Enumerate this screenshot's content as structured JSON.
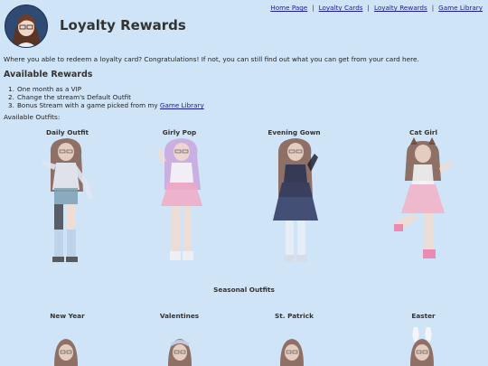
{
  "header": {
    "title": "Loyalty Rewards",
    "nav": [
      "Home Page",
      "Loyalty Cards",
      "Loyalty Rewards",
      "Game Library"
    ],
    "separator": "|"
  },
  "intro": "Where you able to redeem a loyalty card? Congratulations! If not, you can still find out what you can get from your card here.",
  "available_rewards": {
    "heading": "Available Rewards",
    "items": [
      {
        "num": "1.",
        "text": "One month as a VIP"
      },
      {
        "num": "2.",
        "text": "Change the stream's Default Outfit"
      },
      {
        "num": "3.",
        "text": "Bonus Stream with a game picked from my ",
        "link": "Game Library"
      }
    ]
  },
  "outfits_label": "Available Outfits:",
  "outfits": [
    "Daily Outfit",
    "Girly Pop",
    "Evening Gown",
    "Cat Girl"
  ],
  "seasonal": {
    "heading": "Seasonal Outfits",
    "outfits": [
      "New Year",
      "Valentines",
      "St. Patrick",
      "Easter"
    ]
  },
  "colors": {
    "background": "#cfe4f6",
    "link": "#1a1aa6",
    "text": "#222222"
  }
}
